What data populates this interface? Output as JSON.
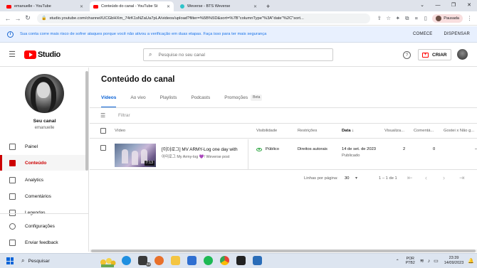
{
  "browser": {
    "tabs": [
      {
        "label": "emanuelle - YouTube",
        "favicon": "youtube-favicon",
        "active": false
      },
      {
        "label": "Conteúdo do canal - YouTube St",
        "favicon": "youtube-studio-favicon",
        "active": true
      },
      {
        "label": "Weverse - BTS Weverse",
        "favicon": "weverse-favicon",
        "active": false
      }
    ],
    "url": "studio.youtube.com/channel/UCGbHXm_74rK1sNZaUa7pLA/videos/upload?filter=%5B%5D&sort=%7B\"columnType\"%3A\"date\"%2C\"sort...",
    "profile_status": "Pausada",
    "new_tab_icon": "+"
  },
  "infobar": {
    "text": "Sua conta corre mais risco de sofrer ataques porque você não ativou a verificação em duas etapas. Faça isso para ter mais segurança",
    "action_primary": "COMECE",
    "action_dismiss": "DISPENSAR"
  },
  "studio": {
    "logo_text": "Studio",
    "search_placeholder": "Pesquise no seu canal",
    "create_label": "CRIAR",
    "help_icon_glyph": "?"
  },
  "sidebar": {
    "channel_title": "Seu canal",
    "channel_name": "emanuelle",
    "items": [
      {
        "label": "Painel",
        "icon": "dashboard-icon",
        "active": false
      },
      {
        "label": "Conteúdo",
        "icon": "content-icon",
        "active": true
      },
      {
        "label": "Analytics",
        "icon": "analytics-icon",
        "active": false
      },
      {
        "label": "Comentários",
        "icon": "comments-icon",
        "active": false
      },
      {
        "label": "Legendas",
        "icon": "subtitles-icon",
        "active": false
      },
      {
        "label": "Configurações",
        "icon": "settings-icon",
        "active": false
      },
      {
        "label": "Enviar feedback",
        "icon": "feedback-icon",
        "active": false
      }
    ]
  },
  "main": {
    "title": "Conteúdo do canal",
    "tabs": [
      {
        "label": "Vídeos",
        "active": true
      },
      {
        "label": "Ao vivo",
        "active": false
      },
      {
        "label": "Playlists",
        "active": false
      },
      {
        "label": "Podcasts",
        "active": false
      },
      {
        "label": "Promoções",
        "active": false,
        "badge": "Beta"
      }
    ],
    "filter_placeholder": "Filtrar",
    "columns": {
      "video": "Vídeo",
      "visibility": "Visibilidade",
      "restrictions": "Restrições",
      "date": "Data",
      "views": "Visualiza...",
      "comments": "Comentá...",
      "likes": "Gostei x Não g..."
    },
    "rows": [
      {
        "title": "[이더로그] MV ARMY-Log one day with",
        "description_prefix": "아미로그 My Army-log ",
        "description_heart": "💜",
        "description_suffix": "! Weverse post",
        "duration": "7:13",
        "visibility": "Público",
        "restrictions": "Direitos autorais",
        "date": "14 de set. de 2023",
        "status": "Publicado",
        "views": "2",
        "comments": "0",
        "likes": "–"
      }
    ],
    "pagination": {
      "rows_per_page_label": "Linhas por página:",
      "rows_per_page": "30",
      "range": "1 – 1 de 1"
    }
  },
  "taskbar": {
    "search_label": "Pesquisar",
    "badge_count": "34",
    "language_line1": "POR",
    "language_line2": "PTB2",
    "time": "23:39",
    "date": "14/09/2023"
  },
  "colors": {
    "accent": "#065fd4",
    "brand_red": "#ff0000",
    "active_nav": "#cc0000",
    "public_green": "#2ba640",
    "info_bg": "#e8f0fe"
  }
}
